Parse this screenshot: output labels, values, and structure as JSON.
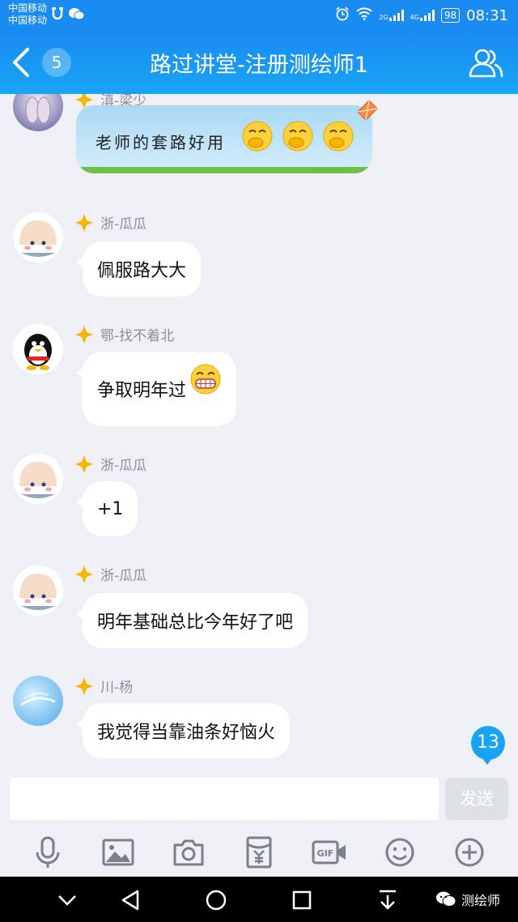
{
  "status_bar": {
    "carrier_1": "中国移动",
    "carrier_2": "中国移动",
    "net_1": "2G",
    "net_2": "4G",
    "battery": "98",
    "time": "08:31"
  },
  "header": {
    "unread_count": "5",
    "title": "路过讲堂-注册测绘师1"
  },
  "messages": [
    {
      "nickname": "滇-梁少",
      "text": "老师的套路好用"
    },
    {
      "nickname": "浙-瓜瓜",
      "text": "佩服路大大"
    },
    {
      "nickname": "鄂-找不着北",
      "text": "争取明年过"
    },
    {
      "nickname": "浙-瓜瓜",
      "text": "+1"
    },
    {
      "nickname": "浙-瓜瓜",
      "text": "明年基础总比今年好了吧"
    },
    {
      "nickname": "川-杨",
      "text": "我觉得当靠油条好恼火"
    }
  ],
  "new_message_count": "13",
  "input": {
    "value": "",
    "send_label": "发送"
  },
  "toolbar_icons": [
    "microphone-icon",
    "image-icon",
    "camera-icon",
    "red-packet-icon",
    "gif-icon",
    "emoji-icon",
    "plus-icon"
  ],
  "nav_icons": [
    "chevron-down-icon",
    "back-triangle-icon",
    "home-circle-icon",
    "recents-square-icon",
    "download-icon"
  ],
  "watermark": "测绘师",
  "colors": {
    "accent": "#1a8bf0",
    "bubble": "#ffffff",
    "background": "#eef0f5"
  }
}
